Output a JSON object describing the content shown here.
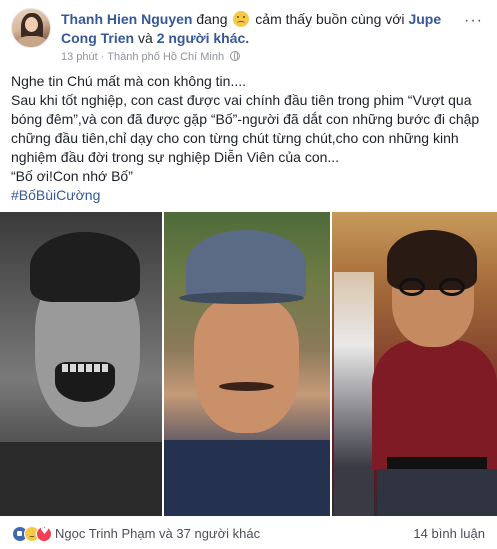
{
  "post": {
    "author": "Thanh Hien Nguyen",
    "feeling_prefix": "đang",
    "feeling_icon": "sad-emoji-icon",
    "feeling_text": "cảm thấy buồn cùng với",
    "tagged_first": "Jupe",
    "tagged_second_line": "Cong Trien",
    "tagged_conjunction": "và",
    "tagged_others": "2 người khác.",
    "time": "13 phút",
    "separator": "·",
    "location": "Thành phố Hồ Chí Minh",
    "privacy_icon": "globe-icon",
    "more_label": "···",
    "text_lines": [
      "Nghe tin Chú mất mà con không tin....",
      "Sau khi tốt nghiệp, con cast được vai chính đầu tiên trong phim “Vượt qua",
      "bóng đêm”,và con đã được gặp “Bố”-người đã dắt con những bước đi chập",
      "chững đầu tiên,chỉ dạy cho con từng chút từng chút,cho con những kinh",
      "nghiệm đầu đời trong sự nghiệp Diễn Viên của con...",
      "“Bố ơi!Con nhớ Bố”"
    ],
    "hashtag": "#BốBùiCường"
  },
  "footer": {
    "reaction_icons": [
      "like-icon",
      "sad-icon",
      "love-icon"
    ],
    "reactors": "Ngọc Trinh Phạm và 37 người khác",
    "comments": "14 bình luận"
  }
}
